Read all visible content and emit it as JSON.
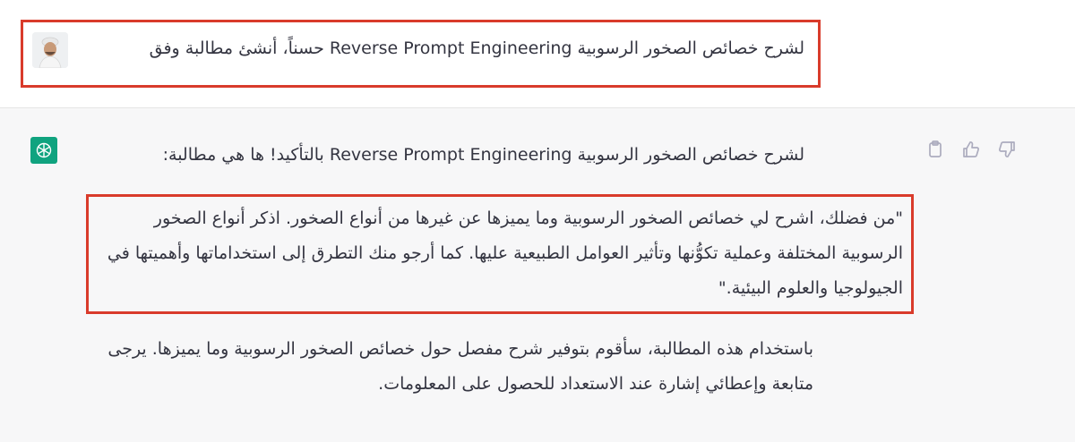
{
  "user_message": {
    "avatar_icon": "user-avatar",
    "text": "لشرح خصائص الصخور الرسوبية Reverse Prompt Engineering حسناً، أنشئ مطالبة وفق"
  },
  "assistant_message": {
    "logo_icon": "openai-logo-icon",
    "intro": "لشرح خصائص الصخور الرسوبية Reverse Prompt Engineering بالتأكيد! ها هي مطالبة:",
    "prompt": "\"من فضلك، اشرح لي خصائص الصخور الرسوبية وما يميزها عن غيرها من أنواع الصخور. اذكر أنواع الصخور الرسوبية المختلفة وعملية تكوُّنها وتأثير العوامل الطبيعية عليها. كما أرجو منك التطرق إلى استخداماتها وأهميتها في الجيولوجيا والعلوم البيئية.\"",
    "closing": "باستخدام هذه المطالبة، سأقوم بتوفير شرح مفصل حول خصائص الصخور الرسوبية وما يميزها. يرجى متابعة وإعطائي إشارة عند الاستعداد للحصول على المعلومات."
  },
  "actions": {
    "copy_icon": "clipboard-icon",
    "like_icon": "thumbs-up-icon",
    "dislike_icon": "thumbs-down-icon"
  },
  "colors": {
    "highlight_border": "#d93b2b",
    "assistant_bg": "#f7f7f8",
    "logo_bg": "#10a37f",
    "icon_gray": "#acacbe"
  }
}
